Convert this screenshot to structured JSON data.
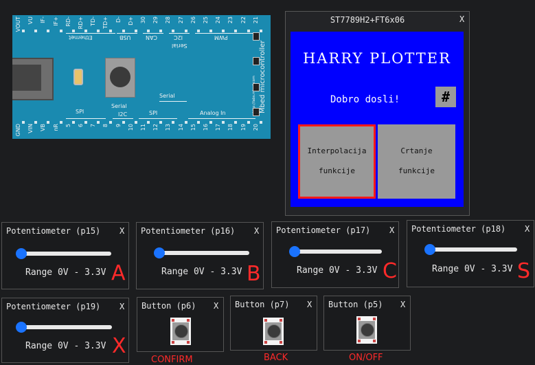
{
  "board": {
    "top_pins": [
      "VOUT",
      "VU",
      "IF-",
      "IF+",
      "RD-",
      "RD+",
      "TD-",
      "TD+",
      "D-",
      "D+",
      "30",
      "29",
      "28",
      "27",
      "26",
      "25",
      "24",
      "23",
      "22",
      "21"
    ],
    "bottom_pins": [
      "GND",
      "VIN",
      "VB",
      "nR",
      "5",
      "6",
      "7",
      "8",
      "9",
      "10",
      "11",
      "12",
      "13",
      "14",
      "15",
      "16",
      "17",
      "18",
      "19",
      "20"
    ],
    "top_groups": {
      "ethernet": "Ethernet",
      "usb": "USB",
      "can": "CAN",
      "i2c": "I2C",
      "serial": "Serial",
      "pwm": "PWM"
    },
    "bottom_groups": {
      "spi1": "SPI",
      "i2c": "I2C",
      "serial_a": "Serial",
      "spi2": "SPI",
      "serial_b": "Serial",
      "analog": "Analog In"
    },
    "side_text": "Mbed microcontroller",
    "url": "http://labs.mbed.com"
  },
  "display": {
    "title": "ST7789H2+FT6x06",
    "close": "X",
    "lcd_title": "HARRY PLOTTER",
    "welcome": "Dobro dosli!",
    "hash": "#",
    "btn_interp_1": "Interpolacija",
    "btn_interp_2": "funkcije",
    "btn_crtanje_1": "Crtanje",
    "btn_crtanje_2": "funkcije"
  },
  "pots": [
    {
      "title": "Potentiometer (p15)",
      "range": "Range 0V - 3.3V",
      "letter": "A",
      "close": "X",
      "level": 0
    },
    {
      "title": "Potentiometer (p16)",
      "range": "Range 0V - 3.3V",
      "letter": "B",
      "close": "X",
      "level": 0
    },
    {
      "title": "Potentiometer (p17)",
      "range": "Range 0V - 3.3V",
      "letter": "C",
      "close": "X",
      "level": 0
    },
    {
      "title": "Potentiometer (p18)",
      "range": "Range 0V - 3.3V",
      "letter": "S",
      "close": "X",
      "level": 0
    },
    {
      "title": "Potentiometer (p19)",
      "range": "Range 0V - 3.3V",
      "letter": "X",
      "close": "X",
      "level": 0
    }
  ],
  "buttons": [
    {
      "title": "Button (p6)",
      "close": "X",
      "caption": "CONFIRM"
    },
    {
      "title": "Button (p7)",
      "close": "X",
      "caption": "BACK"
    },
    {
      "title": "Button (p5)",
      "close": "X",
      "caption": "ON/OFF"
    }
  ],
  "colors": {
    "accent": "#ff2a2a",
    "lcd": "#0000ff",
    "thumb": "#1a73ff",
    "board": "#1a8ab0"
  }
}
